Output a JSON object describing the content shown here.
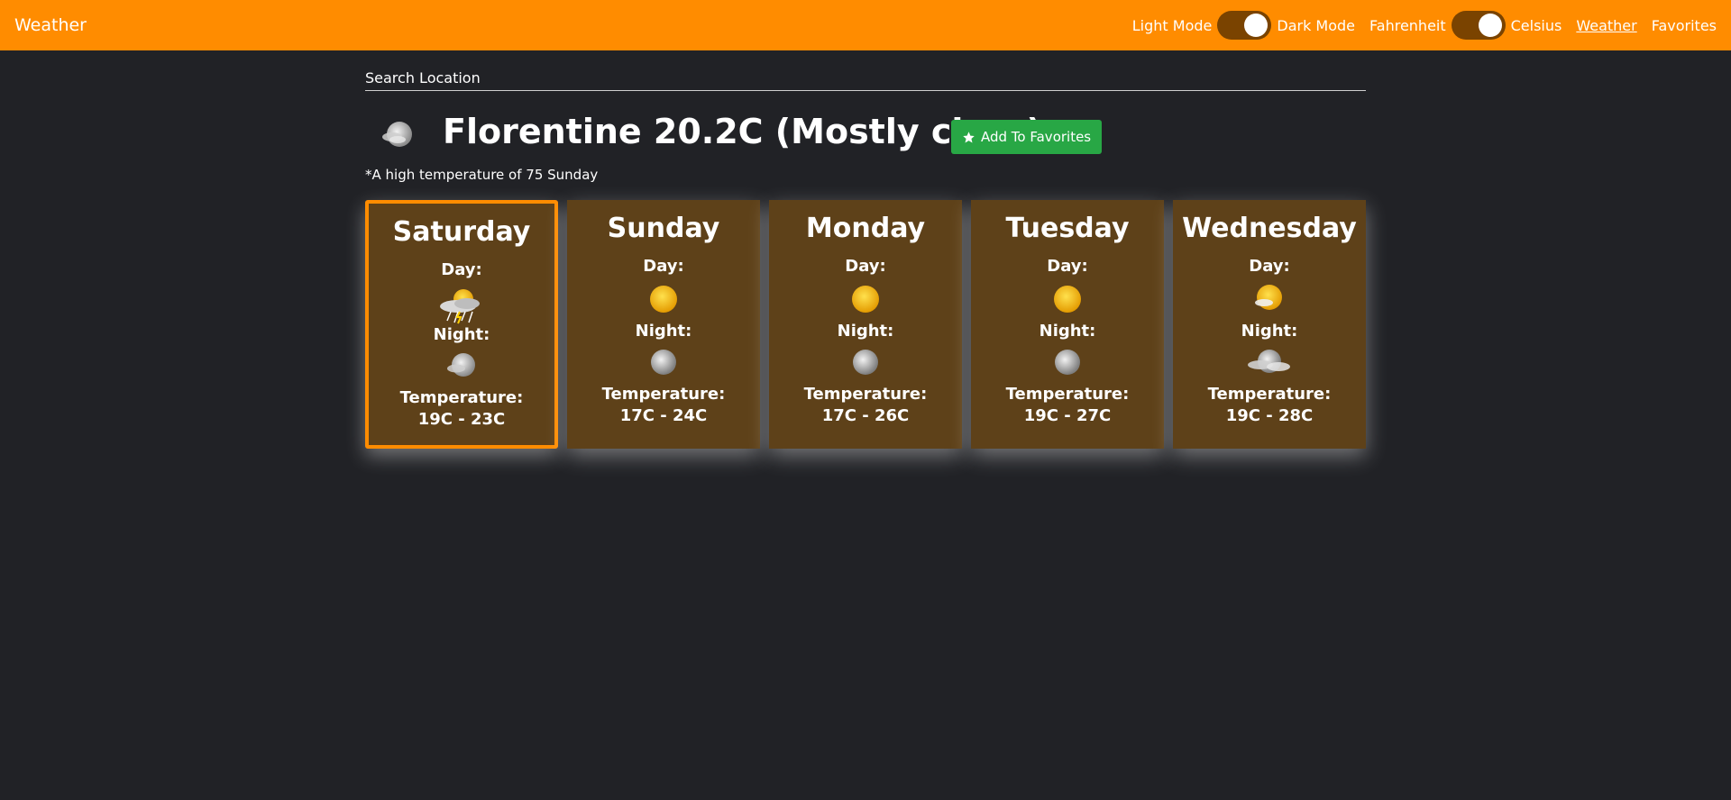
{
  "navbar": {
    "brand": "Weather",
    "light_mode": "Light Mode",
    "dark_mode": "Dark Mode",
    "fahrenheit": "Fahrenheit",
    "celsius": "Celsius",
    "links": [
      "Weather",
      "Favorites"
    ]
  },
  "search": {
    "label": "Search Location"
  },
  "current": {
    "title": "Florentine 20.2C (Mostly clear)",
    "favorite_button": "Add To Favorites",
    "icon": "moon-cloud-icon"
  },
  "note": "*A high temperature of 75 Sunday",
  "forecast": [
    {
      "day": "Saturday",
      "day_label": "Day:",
      "day_icon": "sun-storm-icon",
      "night_label": "Night:",
      "night_icon": "moon-cloud-icon",
      "temp_label": "Temperature:",
      "temp": "19C - 23C"
    },
    {
      "day": "Sunday",
      "day_label": "Day:",
      "day_icon": "sun-icon",
      "night_label": "Night:",
      "night_icon": "moon-icon",
      "temp_label": "Temperature:",
      "temp": "17C - 24C"
    },
    {
      "day": "Monday",
      "day_label": "Day:",
      "day_icon": "sun-icon",
      "night_label": "Night:",
      "night_icon": "moon-icon",
      "temp_label": "Temperature:",
      "temp": "17C - 26C"
    },
    {
      "day": "Tuesday",
      "day_label": "Day:",
      "day_icon": "sun-icon",
      "night_label": "Night:",
      "night_icon": "moon-icon",
      "temp_label": "Temperature:",
      "temp": "19C - 27C"
    },
    {
      "day": "Wednesday",
      "day_label": "Day:",
      "day_icon": "sun-cloud-icon",
      "night_label": "Night:",
      "night_icon": "moon-clouds-icon",
      "temp_label": "Temperature:",
      "temp": "19C - 28C"
    }
  ],
  "colors": {
    "accent": "#ff8c00",
    "background": "#212226",
    "card": "#5e4119",
    "favorite": "#28a745"
  }
}
